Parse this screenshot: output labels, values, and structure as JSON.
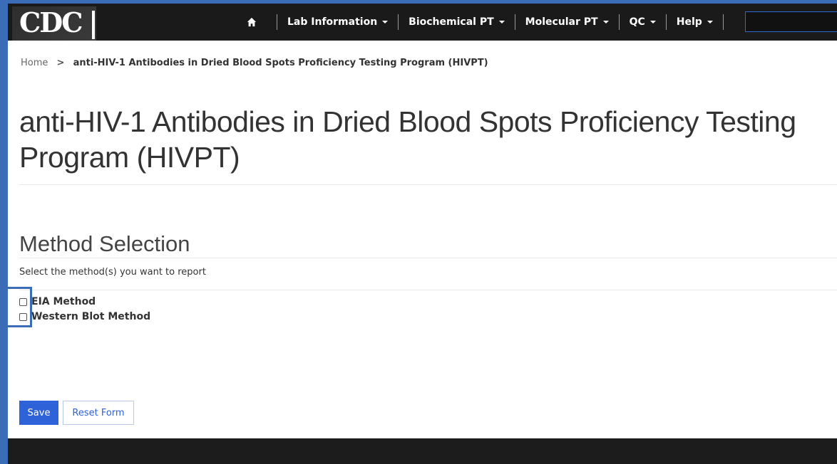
{
  "header": {
    "logo_text": "CDC",
    "nav": [
      {
        "label": "Lab Information"
      },
      {
        "label": "Biochemical PT"
      },
      {
        "label": "Molecular PT"
      },
      {
        "label": "QC"
      },
      {
        "label": "Help"
      }
    ],
    "search": {
      "value": ""
    }
  },
  "breadcrumb": {
    "home": "Home",
    "separator": ">",
    "current": "anti-HIV-1 Antibodies in Dried Blood Spots Proficiency Testing Program (HIVPT)"
  },
  "page_title": "anti-HIV-1 Antibodies in Dried Blood Spots Proficiency Testing Program (HIVPT)",
  "method_selection": {
    "title": "Method Selection",
    "instruction": "Select the method(s) you want to report",
    "options": [
      {
        "label": "EIA Method",
        "checked": false
      },
      {
        "label": "Western Blot Method",
        "checked": false
      }
    ]
  },
  "buttons": {
    "save": "Save",
    "reset": "Reset Form"
  },
  "colors": {
    "accent": "#2d62d8",
    "navbar": "#1a1a1a",
    "annotation_frame": "#3b6cb8"
  }
}
